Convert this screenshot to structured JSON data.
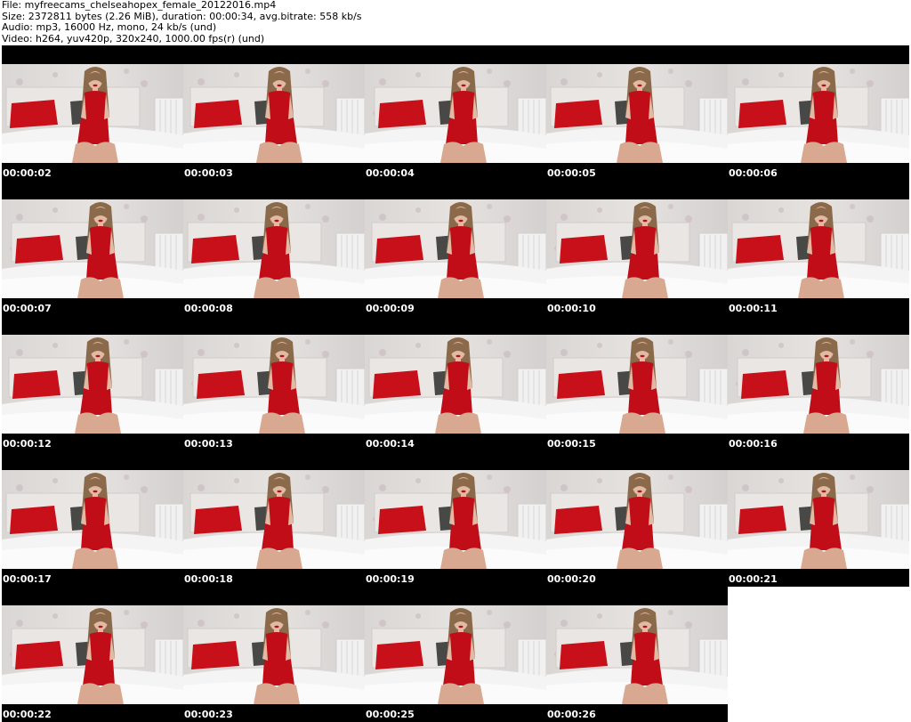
{
  "header": {
    "file_line": "File: myfreecams_chelseahopex_female_20122016.mp4",
    "size_line": "Size: 2372811 bytes (2.26 MiB), duration: 00:00:34, avg.bitrate: 558 kb/s",
    "audio_line": "Audio: mp3, 16000 Hz, mono, 24 kb/s (und)",
    "video_line": "Video: h264, yuv420p, 320x240, 1000.00 fps(r) (und)"
  },
  "thumbnails": [
    {
      "timestamp": "00:00:02"
    },
    {
      "timestamp": "00:00:03"
    },
    {
      "timestamp": "00:00:04"
    },
    {
      "timestamp": "00:00:05"
    },
    {
      "timestamp": "00:00:06"
    },
    {
      "timestamp": "00:00:07"
    },
    {
      "timestamp": "00:00:08"
    },
    {
      "timestamp": "00:00:09"
    },
    {
      "timestamp": "00:00:10"
    },
    {
      "timestamp": "00:00:11"
    },
    {
      "timestamp": "00:00:12"
    },
    {
      "timestamp": "00:00:13"
    },
    {
      "timestamp": "00:00:14"
    },
    {
      "timestamp": "00:00:15"
    },
    {
      "timestamp": "00:00:16"
    },
    {
      "timestamp": "00:00:17"
    },
    {
      "timestamp": "00:00:18"
    },
    {
      "timestamp": "00:00:19"
    },
    {
      "timestamp": "00:00:20"
    },
    {
      "timestamp": "00:00:21"
    },
    {
      "timestamp": "00:00:22"
    },
    {
      "timestamp": "00:00:23"
    },
    {
      "timestamp": "00:00:25"
    },
    {
      "timestamp": "00:00:26"
    }
  ]
}
